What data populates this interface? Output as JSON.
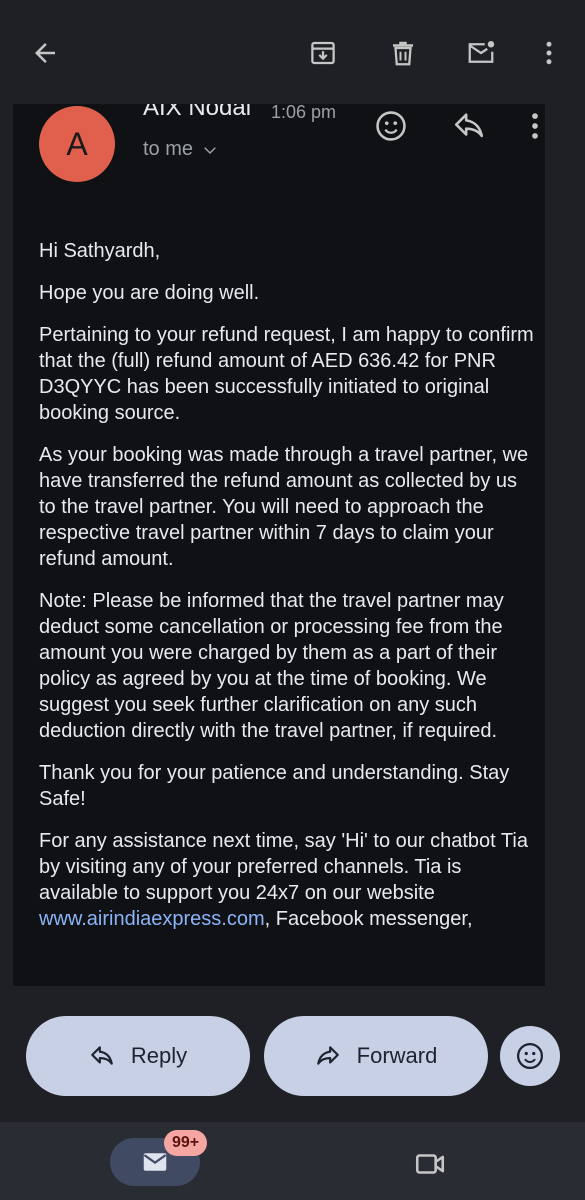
{
  "toolbar": {
    "back_icon": "back-arrow-icon",
    "archive_icon": "archive-icon",
    "delete_icon": "delete-icon",
    "mark_unread_icon": "mark-unread-icon",
    "more_icon": "more-vert-icon"
  },
  "email": {
    "avatar_letter": "A",
    "avatar_color": "#e0604d",
    "sender": "AIX Nodal",
    "time": "1:06 pm",
    "recipient": "to me",
    "paragraphs": [
      "Hi  Sathyardh,",
      "Hope you are doing well.",
      "Pertaining to your refund request, I am happy to confirm that the (full) refund amount of AED 636.42 for PNR D3QYYC has been successfully initiated to original booking source.",
      "As your booking was made through a travel partner, we have transferred the refund amount as collected by us to the travel partner. You will need to approach the respective travel partner within 7 days to claim your refund amount.",
      "Note: Please be informed that the travel partner may deduct some cancellation or processing fee from the amount you were charged by them as a part of their policy as agreed by you at the time of booking. We suggest you seek further clarification on any such deduction directly with the travel partner, if required.",
      "Thank you for your patience and understanding. Stay Safe!"
    ],
    "last_paragraph_pre": "For any assistance next time, say 'Hi' to our chatbot Tia by visiting any of your preferred channels. Tia is available to support you 24x7 on our website ",
    "link_text": "www.airindiaexpress.com",
    "last_paragraph_post": ", Facebook messenger,",
    "link_color": "#8ab4f8"
  },
  "actions": {
    "reply_label": "Reply",
    "forward_label": "Forward"
  },
  "bottom_nav": {
    "mail_badge": "99+",
    "badge_color": "#f6a6a2"
  }
}
